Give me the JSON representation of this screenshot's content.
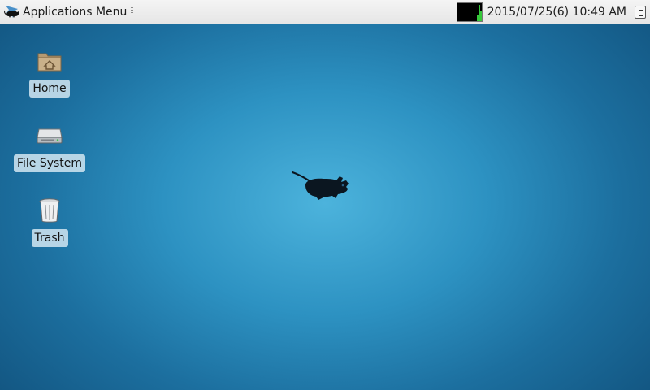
{
  "panel": {
    "app_menu_label": "Applications Menu",
    "clock_text": "2015/07/25(6) 10:49 AM",
    "cpu_graph_color": "#35c93a"
  },
  "desktop": {
    "background_color": "#2d92c2",
    "icons": [
      {
        "label": "Home",
        "icon": "home-folder-icon"
      },
      {
        "label": "File System",
        "icon": "drive-icon"
      },
      {
        "label": "Trash",
        "icon": "trash-icon"
      }
    ],
    "wallpaper_logo": "xfce-mouse-logo"
  }
}
